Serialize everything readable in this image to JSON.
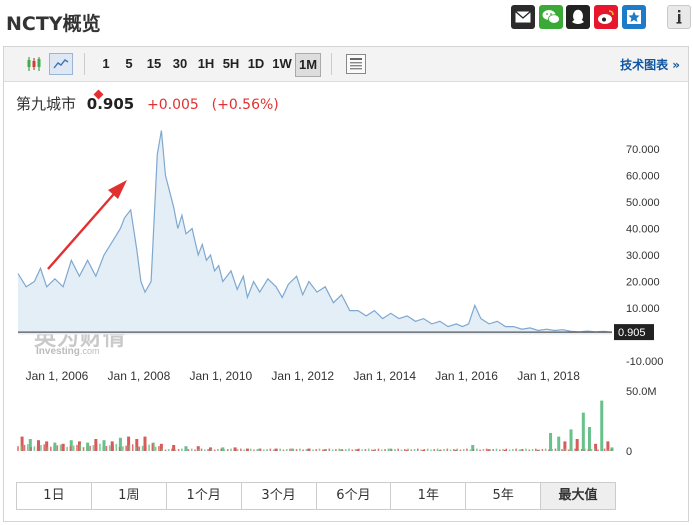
{
  "header": {
    "title": "NCTY概览"
  },
  "share_icons": [
    {
      "name": "email-icon",
      "color": "#2b2b2b"
    },
    {
      "name": "wechat-icon",
      "color": "#3aa935"
    },
    {
      "name": "qq-icon",
      "color": "#222222"
    },
    {
      "name": "weibo-icon",
      "color": "#e6162d"
    },
    {
      "name": "favorite-icon",
      "color": "#1e7bc8"
    },
    {
      "name": "info-icon",
      "color": "#e9e9e9"
    }
  ],
  "toolbar": {
    "intervals": [
      "1",
      "5",
      "15",
      "30",
      "1H",
      "5H",
      "1D",
      "1W",
      "1M"
    ],
    "active_interval": "1M",
    "technical_chart_label": "技术图表 »"
  },
  "quote": {
    "name": "第九城市",
    "price": "0.905",
    "change": "+0.005",
    "change_pct": "(+0.56%)"
  },
  "watermark": {
    "cn": "英为财情",
    "en": "Investing",
    "en_suffix": ".com"
  },
  "colors": {
    "accent": "#e23030",
    "line": "#7fa8cf",
    "area": "#e4eef7",
    "bar_up": "#68c08a",
    "bar_down": "#d85a5a"
  },
  "chart_data": {
    "type": "area",
    "title": "",
    "xlabel": "",
    "ylabel": "",
    "ylim": [
      -10,
      80
    ],
    "x_ticks": [
      {
        "year": 2006,
        "label": "Jan 1, 2006"
      },
      {
        "year": 2008,
        "label": "Jan 1, 2008"
      },
      {
        "year": 2010,
        "label": "Jan 1, 2010"
      },
      {
        "year": 2012,
        "label": "Jan 1, 2012"
      },
      {
        "year": 2014,
        "label": "Jan 1, 2014"
      },
      {
        "year": 2016,
        "label": "Jan 1, 2016"
      },
      {
        "year": 2018,
        "label": "Jan 1, 2018"
      }
    ],
    "y_ticks": [
      "70.000",
      "60.000",
      "50.000",
      "40.000",
      "30.000",
      "20.000",
      "10.000",
      "-10.000"
    ],
    "last_price_label": "0.905",
    "last_price": 0.905,
    "series": [
      {
        "values": [
          [
            2005.0,
            23
          ],
          [
            2005.2,
            18
          ],
          [
            2005.4,
            20
          ],
          [
            2005.55,
            25
          ],
          [
            2005.7,
            18
          ],
          [
            2005.9,
            21
          ],
          [
            2006.1,
            18
          ],
          [
            2006.3,
            28
          ],
          [
            2006.5,
            22
          ],
          [
            2006.7,
            28
          ],
          [
            2006.9,
            22
          ],
          [
            2007.1,
            30
          ],
          [
            2007.3,
            35
          ],
          [
            2007.5,
            40
          ],
          [
            2007.6,
            44
          ],
          [
            2007.75,
            47
          ],
          [
            2007.9,
            32
          ],
          [
            2008.0,
            20
          ],
          [
            2008.1,
            16
          ],
          [
            2008.25,
            20
          ],
          [
            2008.4,
            68
          ],
          [
            2008.5,
            77
          ],
          [
            2008.6,
            60
          ],
          [
            2008.8,
            48
          ],
          [
            2008.9,
            40
          ],
          [
            2009.0,
            45
          ],
          [
            2009.1,
            38
          ],
          [
            2009.25,
            40
          ],
          [
            2009.4,
            30
          ],
          [
            2009.5,
            34
          ],
          [
            2009.6,
            28
          ],
          [
            2009.7,
            30
          ],
          [
            2009.8,
            24
          ],
          [
            2009.9,
            26
          ],
          [
            2010.0,
            20
          ],
          [
            2010.2,
            24
          ],
          [
            2010.35,
            17
          ],
          [
            2010.5,
            22
          ],
          [
            2010.6,
            14
          ],
          [
            2010.75,
            20
          ],
          [
            2010.9,
            16
          ],
          [
            2011.1,
            21
          ],
          [
            2011.3,
            18
          ],
          [
            2011.45,
            14
          ],
          [
            2011.6,
            19
          ],
          [
            2011.8,
            22
          ],
          [
            2011.95,
            15
          ],
          [
            2012.1,
            20
          ],
          [
            2012.3,
            16
          ],
          [
            2012.5,
            18
          ],
          [
            2012.7,
            12
          ],
          [
            2012.9,
            15
          ],
          [
            2013.1,
            9
          ],
          [
            2013.3,
            9
          ],
          [
            2013.5,
            7
          ],
          [
            2013.7,
            9
          ],
          [
            2013.9,
            6
          ],
          [
            2014.1,
            8
          ],
          [
            2014.3,
            6
          ],
          [
            2014.5,
            7
          ],
          [
            2014.7,
            5
          ],
          [
            2014.9,
            6
          ],
          [
            2015.1,
            4
          ],
          [
            2015.3,
            5
          ],
          [
            2015.5,
            3
          ],
          [
            2015.7,
            4
          ],
          [
            2015.85,
            3
          ],
          [
            2016.0,
            4
          ],
          [
            2016.15,
            11
          ],
          [
            2016.3,
            6
          ],
          [
            2016.5,
            4
          ],
          [
            2016.7,
            5
          ],
          [
            2016.9,
            3
          ],
          [
            2017.1,
            3
          ],
          [
            2017.3,
            2
          ],
          [
            2017.5,
            2.5
          ],
          [
            2017.7,
            1.5
          ],
          [
            2017.9,
            2
          ],
          [
            2018.1,
            1.5
          ],
          [
            2018.3,
            1.8
          ],
          [
            2018.5,
            1.2
          ],
          [
            2018.7,
            1
          ],
          [
            2018.9,
            1.3
          ],
          [
            2019.1,
            1
          ],
          [
            2019.3,
            1.2
          ],
          [
            2019.5,
            0.905
          ]
        ]
      }
    ],
    "volume": {
      "y_max_label": "50.0M",
      "y_min_label": "0",
      "max": 50,
      "values": [
        {
          "year": 2005.1,
          "v": 12,
          "up": false
        },
        {
          "year": 2005.3,
          "v": 10,
          "up": true
        },
        {
          "year": 2005.5,
          "v": 9,
          "up": false
        },
        {
          "year": 2005.7,
          "v": 8,
          "up": false
        },
        {
          "year": 2005.9,
          "v": 7,
          "up": true
        },
        {
          "year": 2006.1,
          "v": 6,
          "up": false
        },
        {
          "year": 2006.3,
          "v": 9,
          "up": true
        },
        {
          "year": 2006.5,
          "v": 8,
          "up": false
        },
        {
          "year": 2006.7,
          "v": 7,
          "up": true
        },
        {
          "year": 2006.9,
          "v": 10,
          "up": false
        },
        {
          "year": 2007.1,
          "v": 9,
          "up": true
        },
        {
          "year": 2007.3,
          "v": 8,
          "up": false
        },
        {
          "year": 2007.5,
          "v": 11,
          "up": true
        },
        {
          "year": 2007.7,
          "v": 12,
          "up": false
        },
        {
          "year": 2007.9,
          "v": 10,
          "up": false
        },
        {
          "year": 2008.1,
          "v": 12,
          "up": false
        },
        {
          "year": 2008.3,
          "v": 7,
          "up": true
        },
        {
          "year": 2008.5,
          "v": 6,
          "up": false
        },
        {
          "year": 2008.8,
          "v": 5,
          "up": false
        },
        {
          "year": 2009.1,
          "v": 4,
          "up": true
        },
        {
          "year": 2009.4,
          "v": 4,
          "up": false
        },
        {
          "year": 2009.7,
          "v": 3,
          "up": false
        },
        {
          "year": 2010.0,
          "v": 3,
          "up": true
        },
        {
          "year": 2010.3,
          "v": 3,
          "up": false
        },
        {
          "year": 2010.6,
          "v": 2,
          "up": false
        },
        {
          "year": 2010.9,
          "v": 2,
          "up": true
        },
        {
          "year": 2011.3,
          "v": 2,
          "up": false
        },
        {
          "year": 2011.7,
          "v": 2,
          "up": true
        },
        {
          "year": 2012.1,
          "v": 2,
          "up": false
        },
        {
          "year": 2012.5,
          "v": 1.5,
          "up": false
        },
        {
          "year": 2012.9,
          "v": 1.5,
          "up": true
        },
        {
          "year": 2013.3,
          "v": 1.5,
          "up": false
        },
        {
          "year": 2013.7,
          "v": 1,
          "up": false
        },
        {
          "year": 2014.1,
          "v": 2,
          "up": true
        },
        {
          "year": 2014.5,
          "v": 1,
          "up": false
        },
        {
          "year": 2014.9,
          "v": 1,
          "up": false
        },
        {
          "year": 2015.3,
          "v": 1,
          "up": true
        },
        {
          "year": 2015.7,
          "v": 1,
          "up": false
        },
        {
          "year": 2016.1,
          "v": 5,
          "up": true
        },
        {
          "year": 2016.5,
          "v": 1.5,
          "up": false
        },
        {
          "year": 2016.9,
          "v": 1,
          "up": false
        },
        {
          "year": 2017.3,
          "v": 1.5,
          "up": true
        },
        {
          "year": 2017.7,
          "v": 1,
          "up": false
        },
        {
          "year": 2018.0,
          "v": 15,
          "up": true
        },
        {
          "year": 2018.2,
          "v": 12,
          "up": true
        },
        {
          "year": 2018.35,
          "v": 8,
          "up": false
        },
        {
          "year": 2018.5,
          "v": 18,
          "up": true
        },
        {
          "year": 2018.65,
          "v": 10,
          "up": false
        },
        {
          "year": 2018.8,
          "v": 32,
          "up": true
        },
        {
          "year": 2018.95,
          "v": 20,
          "up": true
        },
        {
          "year": 2019.1,
          "v": 6,
          "up": false
        },
        {
          "year": 2019.25,
          "v": 42,
          "up": true
        },
        {
          "year": 2019.4,
          "v": 8,
          "up": false
        },
        {
          "year": 2019.5,
          "v": 3,
          "up": true
        }
      ]
    }
  },
  "ranges": [
    "1日",
    "1周",
    "1个月",
    "3个月",
    "6个月",
    "1年",
    "5年",
    "最大值"
  ],
  "active_range": "最大值"
}
